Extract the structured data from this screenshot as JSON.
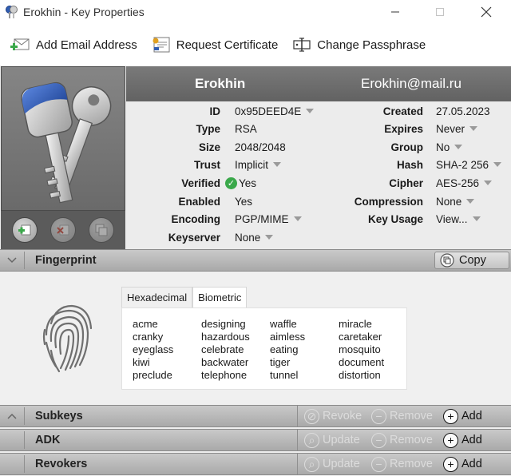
{
  "window": {
    "title": "Erokhin - Key Properties"
  },
  "toolbar": {
    "add_email": "Add Email Address",
    "request_certificate": "Request Certificate",
    "change_passphrase": "Change Passphrase"
  },
  "key": {
    "name": "Erokhin",
    "email": "Erokhin@mail.ru"
  },
  "left_props": [
    {
      "label": "ID",
      "value": "0x95DEED4E",
      "dropdown": true
    },
    {
      "label": "Type",
      "value": "RSA",
      "dropdown": false
    },
    {
      "label": "Size",
      "value": "2048/2048",
      "dropdown": false
    },
    {
      "label": "Trust",
      "value": "Implicit",
      "dropdown": true
    },
    {
      "label": "Verified",
      "value": "Yes",
      "dropdown": false,
      "check": true
    },
    {
      "label": "Enabled",
      "value": "Yes",
      "dropdown": false
    },
    {
      "label": "Encoding",
      "value": "PGP/MIME",
      "dropdown": true
    },
    {
      "label": "Keyserver",
      "value": "None",
      "dropdown": true
    }
  ],
  "right_props": [
    {
      "label": "Created",
      "value": "27.05.2023",
      "dropdown": false
    },
    {
      "label": "Expires",
      "value": "Never",
      "dropdown": true
    },
    {
      "label": "Group",
      "value": "No",
      "dropdown": true
    },
    {
      "label": "Hash",
      "value": "SHA-2 256",
      "dropdown": true
    },
    {
      "label": "Cipher",
      "value": "AES-256",
      "dropdown": true
    },
    {
      "label": "Compression",
      "value": "None",
      "dropdown": true
    },
    {
      "label": "Key Usage",
      "value": "View...",
      "dropdown": true
    }
  ],
  "fingerprint": {
    "title": "Fingerprint",
    "copy_label": "Copy",
    "tabs": [
      "Hexadecimal",
      "Biometric"
    ],
    "active_tab": "Biometric",
    "words": [
      [
        "acme",
        "cranky",
        "eyeglass",
        "kiwi",
        "preclude"
      ],
      [
        "designing",
        "hazardous",
        "celebrate",
        "backwater",
        "telephone"
      ],
      [
        "waffle",
        "aimless",
        "eating",
        "tiger",
        "tunnel"
      ],
      [
        "miracle",
        "caretaker",
        "mosquito",
        "document",
        "distortion"
      ]
    ]
  },
  "sections": {
    "subkeys": {
      "title": "Subkeys",
      "revoke": "Revoke",
      "remove": "Remove",
      "add": "Add"
    },
    "adk": {
      "title": "ADK",
      "update": "Update",
      "remove": "Remove",
      "add": "Add"
    },
    "revokers": {
      "title": "Revokers",
      "update": "Update",
      "remove": "Remove",
      "add": "Add"
    }
  },
  "colors": {
    "header": "#6e6e6e",
    "verified": "#3aa84a",
    "key_blue": "#2f5db3"
  }
}
